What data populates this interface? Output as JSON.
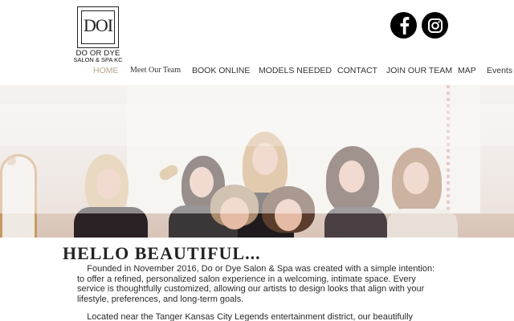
{
  "logo": {
    "monogram": "DOI",
    "name": "DO OR DYE",
    "subtitle": "SALON & SPA KC"
  },
  "social": [
    {
      "icon": "facebook-icon"
    },
    {
      "icon": "instagram-icon"
    }
  ],
  "nav": {
    "items": [
      {
        "label": "HOME",
        "active": true
      },
      {
        "label": "Meet Our Team"
      },
      {
        "label": "BOOK ONLINE"
      },
      {
        "label": "MODELS NEEDED"
      },
      {
        "label": "CONTACT"
      },
      {
        "label": "JOIN OUR TEAM"
      },
      {
        "label": "MAP"
      },
      {
        "label": "Events"
      }
    ]
  },
  "colors": {
    "active_nav": "#b7a68a",
    "social_bg": "#000000",
    "text": "#222222"
  },
  "content": {
    "headline": "HELLO BEAUTIFUL...",
    "paragraph_1": "Founded in November 2016, Do or Dye Salon & Spa was created with a simple intention: to offer a refined, personalized salon experience in a welcoming, intimate space. Every service is thoughtfully customized, allowing our artists to design looks that align with your lifestyle, preferences, and long-term goals.",
    "paragraph_2": "Located near the Tanger Kansas City Legends entertainment district, our beautifully"
  }
}
